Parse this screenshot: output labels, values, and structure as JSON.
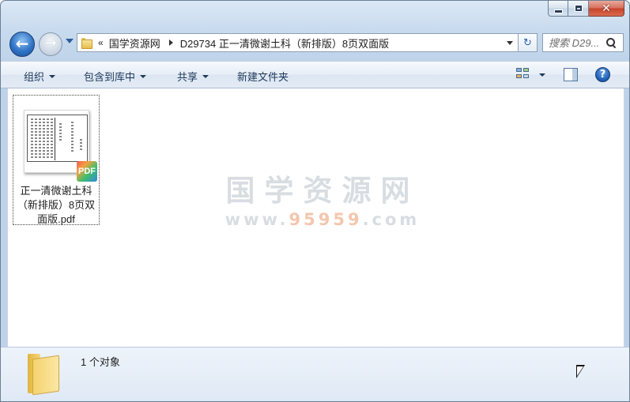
{
  "window": {
    "close_glyph": "✕"
  },
  "nav": {
    "back_glyph": "←",
    "forward_glyph": "→"
  },
  "address": {
    "overflow": "«",
    "crumbs": [
      "国学资源网",
      "D29734 正一清微谢土科（新排版）8页双面版"
    ]
  },
  "refresh_glyph": "↻",
  "search": {
    "placeholder": "搜索 D29..."
  },
  "toolbar": {
    "organize": "组织",
    "include_library": "包含到库中",
    "share": "共享",
    "new_folder": "新建文件夹",
    "help": "?"
  },
  "files": [
    {
      "name": "正一清微谢土科（新排版）8页双面版.pdf",
      "badge": "PDF",
      "icon": "pdf-file-icon"
    }
  ],
  "watermark": {
    "title": "国学资源网",
    "url_prefix": "www.",
    "url_highlight": "95959",
    "url_suffix": ".com"
  },
  "details": {
    "count": "1 个对象"
  }
}
